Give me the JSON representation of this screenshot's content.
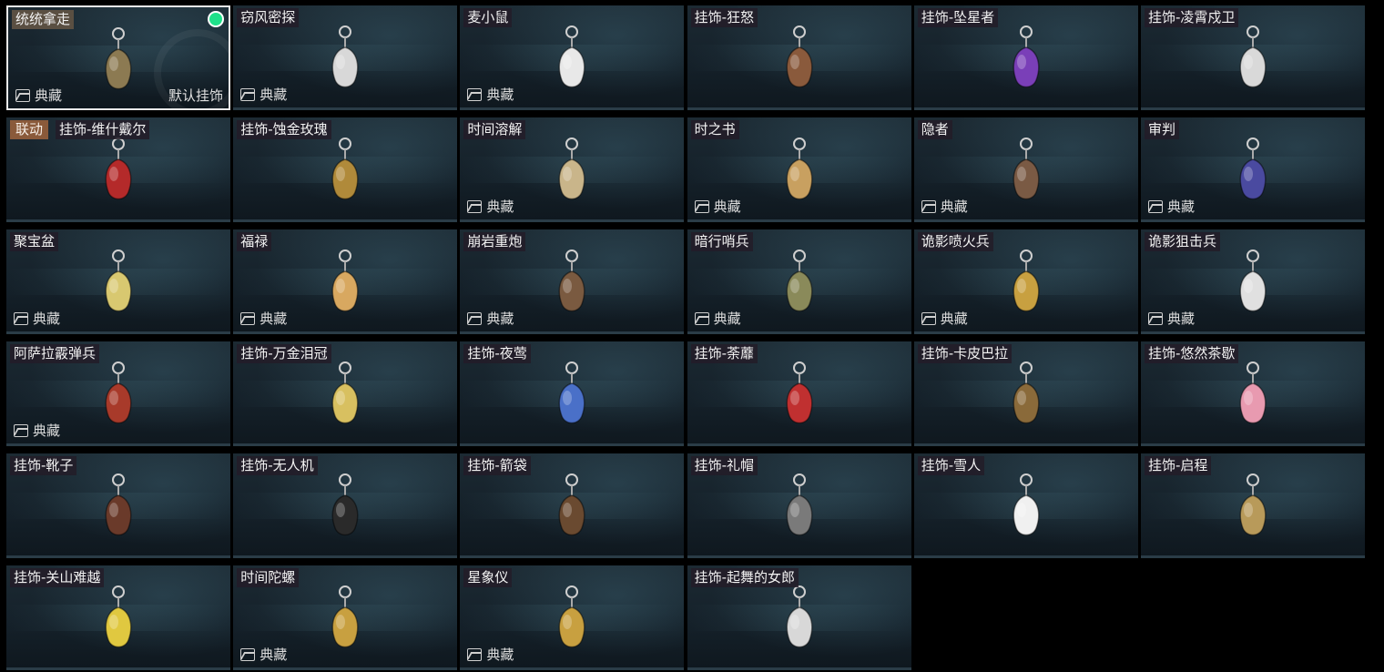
{
  "grid": {
    "items": [
      {
        "name": "统统拿走",
        "collection": "典藏",
        "selected": true,
        "active": true,
        "default_label": "默认挂饰",
        "icon": "skull-charm-icon",
        "color": "#8c7a52"
      },
      {
        "name": "窃风密探",
        "collection": "典藏",
        "icon": "rabbit-agent-charm-icon",
        "color": "#d8d8d8"
      },
      {
        "name": "麦小鼠",
        "collection": "典藏",
        "icon": "mouse-charm-icon",
        "color": "#e8e8e8"
      },
      {
        "name": "挂饰-狂怒",
        "icon": "hammer-charm-icon",
        "color": "#8a5a3c"
      },
      {
        "name": "挂饰-坠星者",
        "icon": "purple-crystal-charm-icon",
        "color": "#7a3fb8"
      },
      {
        "name": "挂饰-凌霄戍卫",
        "icon": "rocket-charm-icon",
        "color": "#d9d9d9"
      },
      {
        "name": "挂饰-维什戴尔",
        "collab": "联动",
        "icon": "card-charm-icon",
        "color": "#b42a2a"
      },
      {
        "name": "挂饰-蚀金玫瑰",
        "icon": "gold-rose-charm-icon",
        "color": "#b08a3a"
      },
      {
        "name": "时间溶解",
        "collection": "典藏",
        "icon": "melting-clock-charm-icon",
        "color": "#c9b58a"
      },
      {
        "name": "时之书",
        "collection": "典藏",
        "icon": "book-charm-icon",
        "color": "#c8a060"
      },
      {
        "name": "隐者",
        "collection": "典藏",
        "icon": "tarot-hermit-charm-icon",
        "color": "#7a5a44"
      },
      {
        "name": "审判",
        "collection": "典藏",
        "icon": "tarot-judgement-charm-icon",
        "color": "#4a4aa0"
      },
      {
        "name": "聚宝盆",
        "collection": "典藏",
        "icon": "treasure-bowl-charm-icon",
        "color": "#d8c870"
      },
      {
        "name": "福禄",
        "collection": "典藏",
        "icon": "gourd-charm-icon",
        "color": "#d8a860"
      },
      {
        "name": "崩岩重炮",
        "collection": "典藏",
        "icon": "heavy-cannon-charm-icon",
        "color": "#7a5a40"
      },
      {
        "name": "暗行哨兵",
        "collection": "典藏",
        "icon": "sentinel-charm-icon",
        "color": "#8a8a5a"
      },
      {
        "name": "诡影喷火兵",
        "collection": "典藏",
        "icon": "flamethrower-charm-icon",
        "color": "#c8a040"
      },
      {
        "name": "诡影狙击兵",
        "collection": "典藏",
        "icon": "sniper-charm-icon",
        "color": "#e0e0e0"
      },
      {
        "name": "阿萨拉霰弹兵",
        "collection": "典藏",
        "icon": "shotgunner-charm-icon",
        "color": "#a83a2a"
      },
      {
        "name": "挂饰-万金泪冠",
        "icon": "gold-crown-charm-icon",
        "color": "#d8c060"
      },
      {
        "name": "挂饰-夜莺",
        "icon": "nightingale-feather-charm-icon",
        "color": "#4a70c8"
      },
      {
        "name": "挂饰-荼蘼",
        "icon": "flower-charm-icon",
        "color": "#c03030"
      },
      {
        "name": "挂饰-卡皮巴拉",
        "icon": "capybara-charm-icon",
        "color": "#8a6a3a"
      },
      {
        "name": "挂饰-悠然茶歇",
        "icon": "cupcake-charm-icon",
        "color": "#e89ab0"
      },
      {
        "name": "挂饰-靴子",
        "icon": "boot-charm-icon",
        "color": "#6a3a2a"
      },
      {
        "name": "挂饰-无人机",
        "icon": "drone-charm-icon",
        "color": "#2a2a2a"
      },
      {
        "name": "挂饰-箭袋",
        "icon": "quiver-charm-icon",
        "color": "#6a4a30"
      },
      {
        "name": "挂饰-礼帽",
        "icon": "hat-charm-icon",
        "color": "#7a7a7a"
      },
      {
        "name": "挂饰-雪人",
        "icon": "snowman-charm-icon",
        "color": "#f0f0f0"
      },
      {
        "name": "挂饰-启程",
        "icon": "medal-charm-icon",
        "color": "#b89a5a"
      },
      {
        "name": "挂饰-关山难越",
        "icon": "gold-bar-charm-icon",
        "color": "#e0c840"
      },
      {
        "name": "时间陀螺",
        "collection": "典藏",
        "icon": "spinning-top-charm-icon",
        "color": "#c8a040"
      },
      {
        "name": "星象仪",
        "collection": "典藏",
        "icon": "astrolabe-charm-icon",
        "color": "#c8a040"
      },
      {
        "name": "挂饰-起舞的女郎",
        "icon": "dancer-charm-icon",
        "color": "#d8d8d8"
      }
    ]
  }
}
